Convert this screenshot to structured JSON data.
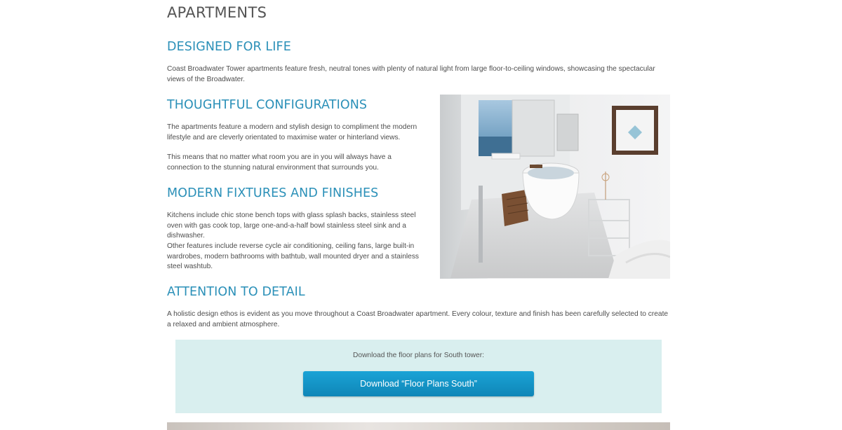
{
  "page": {
    "title": "APARTMENTS"
  },
  "sections": {
    "designed": {
      "heading": "DESIGNED FOR LIFE",
      "body": "Coast Broadwater Tower apartments feature fresh, neutral tones with plenty of natural light from large floor-to-ceiling windows, showcasing the spectacular views of the Broadwater."
    },
    "configurations": {
      "heading": "THOUGHTFUL CONFIGURATIONS",
      "body1": "The apartments feature a modern and stylish design to compliment the modern lifestyle and are cleverly orientated to maximise water or hinterland views.",
      "body2": "This means that no matter what room you are in you will always have a connection to the stunning natural environment that surrounds you."
    },
    "fixtures": {
      "heading": "MODERN FIXTURES AND FINISHES",
      "body1": "Kitchens include chic stone bench tops with glass splash backs, stainless steel oven with gas cook top, large one-and-a-half bowl stainless steel sink and a dishwasher.",
      "body2": "Other features include reverse cycle air conditioning, ceiling fans, large built-in wardrobes, modern bathrooms with bathtub, wall mounted dryer and a stainless steel washtub."
    },
    "detail": {
      "heading": "ATTENTION TO DETAIL",
      "body": "A holistic design ethos is evident as you move throughout a Coast Broadwater apartment. Every colour, texture and finish has been carefully selected to create a relaxed and ambient atmosphere."
    }
  },
  "download": {
    "label": "Download the floor plans for South tower:",
    "button_label": "Download “Floor Plans South”"
  },
  "colors": {
    "heading_blue": "#2b90b8",
    "box_background": "#d9efef",
    "button_blue": "#1396c8"
  }
}
